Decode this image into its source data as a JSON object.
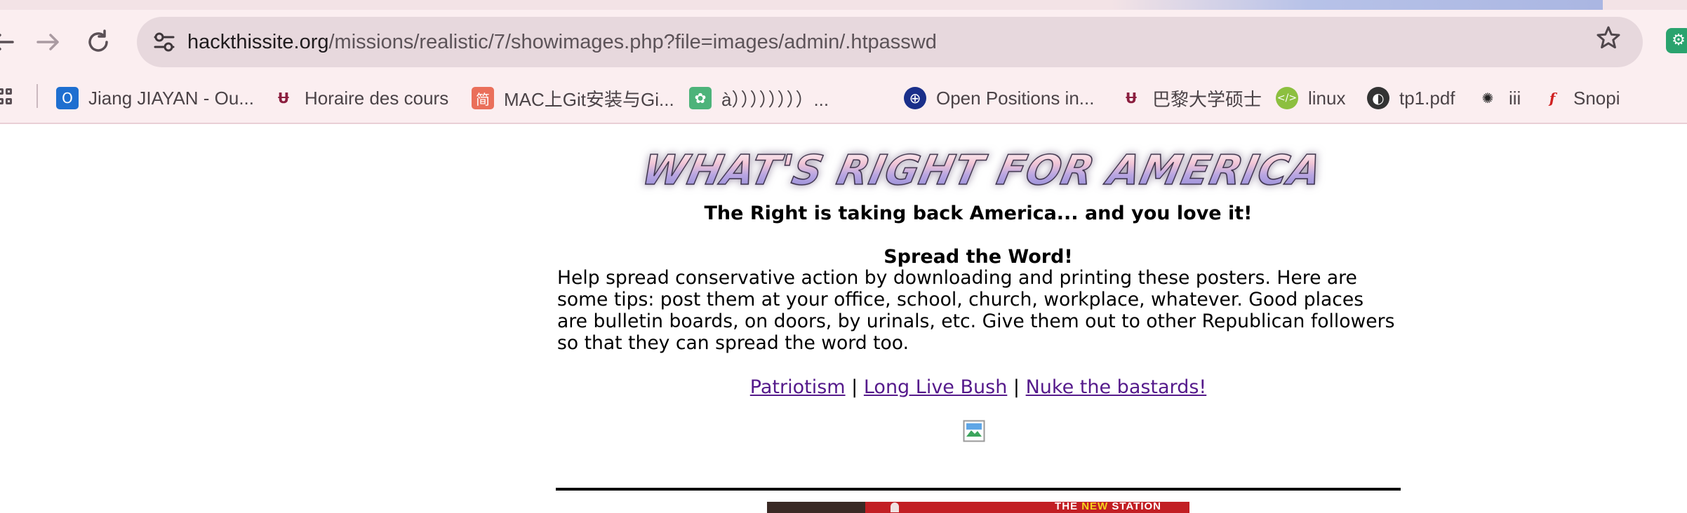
{
  "browser": {
    "url_host": "hackthissite.org",
    "url_path": "/missions/realistic/7/showimages.php?file=images/admin/.htpasswd",
    "back_icon": "arrow-left-icon",
    "forward_icon": "arrow-right-icon",
    "reload_icon": "reload-icon",
    "site_info_icon": "tune-icon",
    "bookmark_star_icon": "star-icon",
    "extension_icon": "chatgpt-icon",
    "bookmarks": [
      {
        "label": "Jiang JIAYAN - Ou...",
        "icon": "outlook-icon",
        "color": "#1e6fd0"
      },
      {
        "label": "Horaire des cours",
        "icon": "university-logo-icon",
        "color": "#8b1e3f"
      },
      {
        "label": "MAC上Git安装与Gi...",
        "icon": "jianshu-icon",
        "color": "#ea6f5a"
      },
      {
        "label": "à））））））））...",
        "icon": "paw-icon",
        "color": "#4db37a"
      },
      {
        "label": "Open Positions in...",
        "icon": "globe-icon",
        "color": "#1a2f8a"
      },
      {
        "label": "巴黎大学硕士",
        "icon": "university-logo-icon",
        "color": "#8b1e3f"
      },
      {
        "label": "linux",
        "icon": "code-icon",
        "color": "#8cbf3f"
      },
      {
        "label": "tp1.pdf",
        "icon": "globe-icon",
        "color": "#333333"
      },
      {
        "label": "iii",
        "icon": "openai-icon",
        "color": "#222222"
      },
      {
        "label": "Snopi",
        "icon": "f-script-icon",
        "color": "#d02020"
      }
    ]
  },
  "page": {
    "banner": "WHAT'S RIGHT FOR AMERICA",
    "tagline": "The Right is taking back America... and you love it!",
    "subhead": "Spread the Word!",
    "body": "Help spread conservative action by downloading and printing these posters. Here are some tips: post them at your office, school, church, workplace, whatever. Good places are bulletin boards, on doors, by urinals, etc. Give them out to other Republican followers so that they can spread the word too.",
    "links": [
      "Patriotism",
      "Long Live Bush",
      "Nuke the bastards!"
    ],
    "link_separator": "|",
    "poster_text_new": "NEW",
    "poster_text_the": "THE",
    "poster_text_station": "STATION"
  }
}
